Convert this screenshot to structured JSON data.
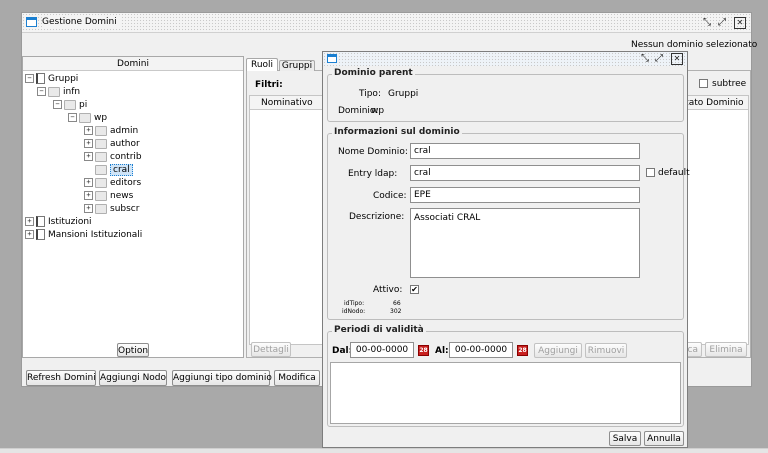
{
  "window": {
    "title": "Gestione Domini",
    "status_text": "Nessun dominio selezionato"
  },
  "tree_panel": {
    "header": "Domini",
    "option_button": "Option",
    "items": [
      {
        "label": "Gruppi",
        "expander": "−"
      },
      {
        "label": "infn",
        "expander": "−"
      },
      {
        "label": "pi",
        "expander": "−"
      },
      {
        "label": "wp",
        "expander": "−"
      },
      {
        "label": "admin",
        "expander": "+"
      },
      {
        "label": "author",
        "expander": "+"
      },
      {
        "label": "contrib",
        "expander": "+"
      },
      {
        "label": "cral",
        "expander": ""
      },
      {
        "label": "editors",
        "expander": "+"
      },
      {
        "label": "news",
        "expander": "+"
      },
      {
        "label": "subscr",
        "expander": "+"
      },
      {
        "label": "Istituzioni",
        "expander": "+"
      },
      {
        "label": "Mansioni Istituzionali",
        "expander": "+"
      }
    ]
  },
  "toolbar": {
    "refresh": "Refresh Domini",
    "add_node": "Aggiungi Nodo",
    "add_type": "Aggiungi tipo dominio",
    "modify": "Modifica"
  },
  "middle_panel": {
    "tabs": [
      "Ruoli",
      "Gruppi"
    ],
    "filters_label": "Filtri:",
    "column_nominativo": "Nominativo",
    "column_right": "zato Dominio",
    "subtree_label": "subtree",
    "dettagli_button": "Dettagli",
    "ca_button": "ca",
    "elimina_button": "Elimina"
  },
  "dialog": {
    "parent_section": {
      "legend": "Dominio parent",
      "tipo_label": "Tipo:",
      "tipo_value": "Gruppi",
      "dominio_label": "Dominio:",
      "dominio_value": "wp"
    },
    "info_section": {
      "legend": "Informazioni sul dominio",
      "nome_label": "Nome Dominio:",
      "nome_value": "cral",
      "ldap_label": "Entry ldap:",
      "ldap_value": "cral",
      "default_label": "default",
      "codice_label": "Codice:",
      "codice_value": "EPE",
      "descr_label": "Descrizione:",
      "descr_value": "Associati CRAL",
      "attivo_label": "Attivo:",
      "attivo_checked": "✔",
      "idtipo_label": "idTipo:",
      "idtipo_value": "66",
      "idnodo_label": "idNodo:",
      "idnodo_value": "302"
    },
    "periodi_section": {
      "legend": "Periodi di validità",
      "dal_label": "Dal:",
      "dal_value": "00-00-0000",
      "al_label": "Al:",
      "al_value": "00-00-0000",
      "cal_text": "28",
      "aggiungi": "Aggiungi",
      "rimuovi": "Rimuovi"
    },
    "salva": "Salva",
    "annulla": "Annulla"
  },
  "colors": {
    "accent": "#1a7fd1",
    "selected": "#cfe4f7",
    "calendar": "#c8201f"
  }
}
